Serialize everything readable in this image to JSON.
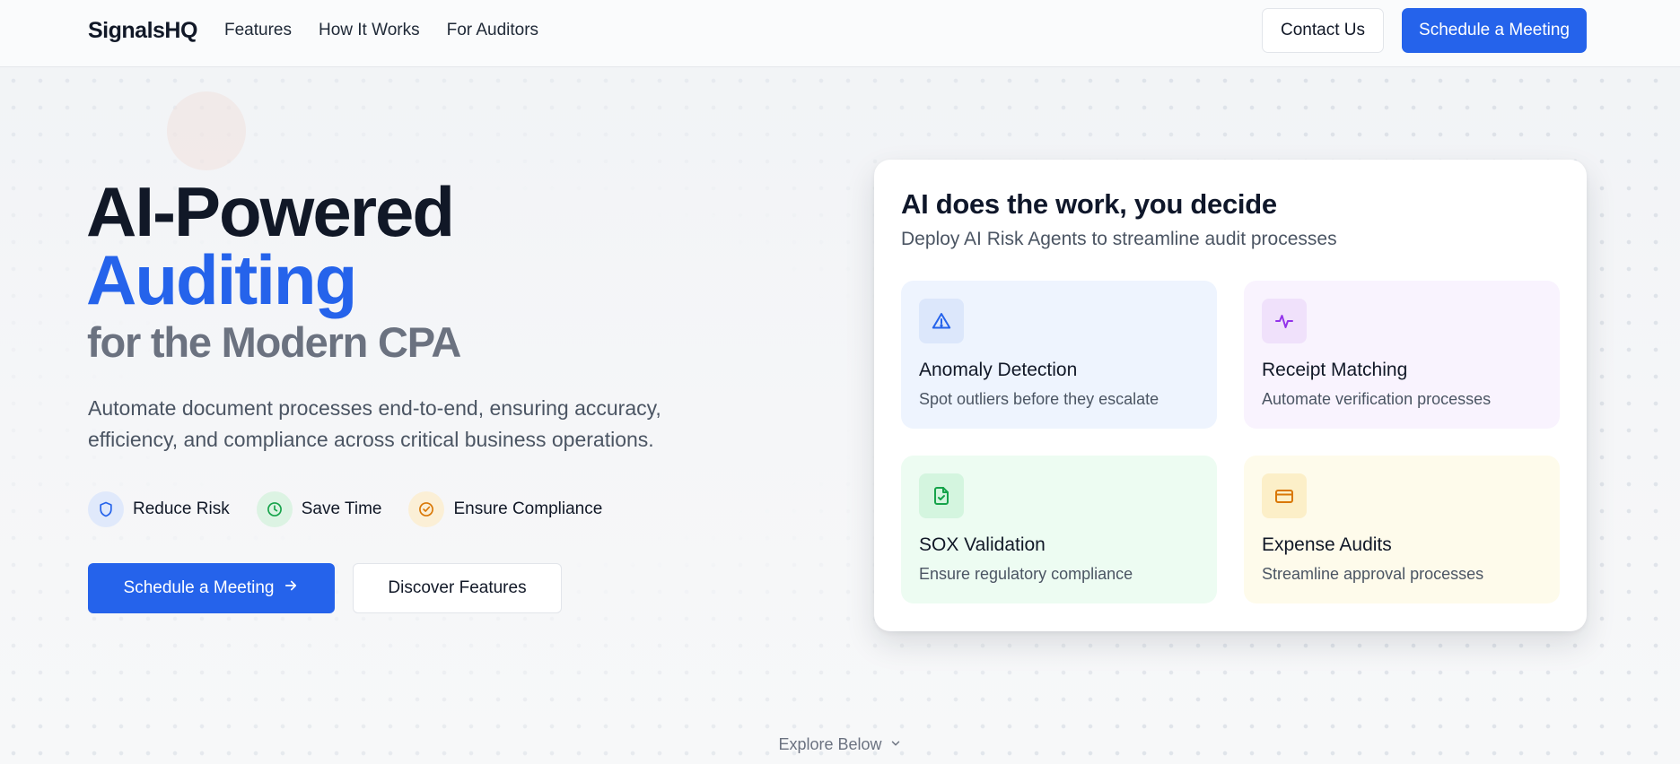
{
  "nav": {
    "logo": "SignalsHQ",
    "links": [
      "Features",
      "How It Works",
      "For Auditors"
    ],
    "contact_label": "Contact Us",
    "schedule_label": "Schedule a Meeting"
  },
  "hero": {
    "title_line1": "AI-Powered",
    "title_line2": "Auditing",
    "title_line3": "for the Modern CPA",
    "lede": "Automate document processes end-to-end, ensuring accuracy, efficiency, and compliance across critical business operations.",
    "benefits": [
      {
        "label": "Reduce Risk",
        "icon": "shield-icon",
        "color": "#2563eb",
        "bg": "#e0e9fb"
      },
      {
        "label": "Save Time",
        "icon": "clock-icon",
        "color": "#16a34a",
        "bg": "#dcf3e3"
      },
      {
        "label": "Ensure Compliance",
        "icon": "check-circle-icon",
        "color": "#d97706",
        "bg": "#fbefd6"
      }
    ],
    "primary_cta": "Schedule a Meeting",
    "secondary_cta": "Discover Features",
    "explore": "Explore Below"
  },
  "card": {
    "title": "AI does the work, you decide",
    "subtitle": "Deploy AI Risk Agents to streamline audit processes",
    "tiles": [
      {
        "title": "Anomaly Detection",
        "desc": "Spot outliers before they escalate",
        "icon": "alert-triangle-icon",
        "bg": "#eef4fe",
        "icon_bg": "#dce7fb",
        "color": "#2563eb"
      },
      {
        "title": "Receipt Matching",
        "desc": "Automate verification processes",
        "icon": "activity-icon",
        "bg": "#f9f3fe",
        "icon_bg": "#f0e1fb",
        "color": "#9333ea"
      },
      {
        "title": "SOX Validation",
        "desc": "Ensure regulatory compliance",
        "icon": "file-check-icon",
        "bg": "#edfcf2",
        "icon_bg": "#d4f5df",
        "color": "#16a34a"
      },
      {
        "title": "Expense Audits",
        "desc": "Streamline approval processes",
        "icon": "credit-card-icon",
        "bg": "#fefbeb",
        "icon_bg": "#fcefc8",
        "color": "#d97706"
      }
    ]
  },
  "colors": {
    "accent": "#2563eb"
  }
}
